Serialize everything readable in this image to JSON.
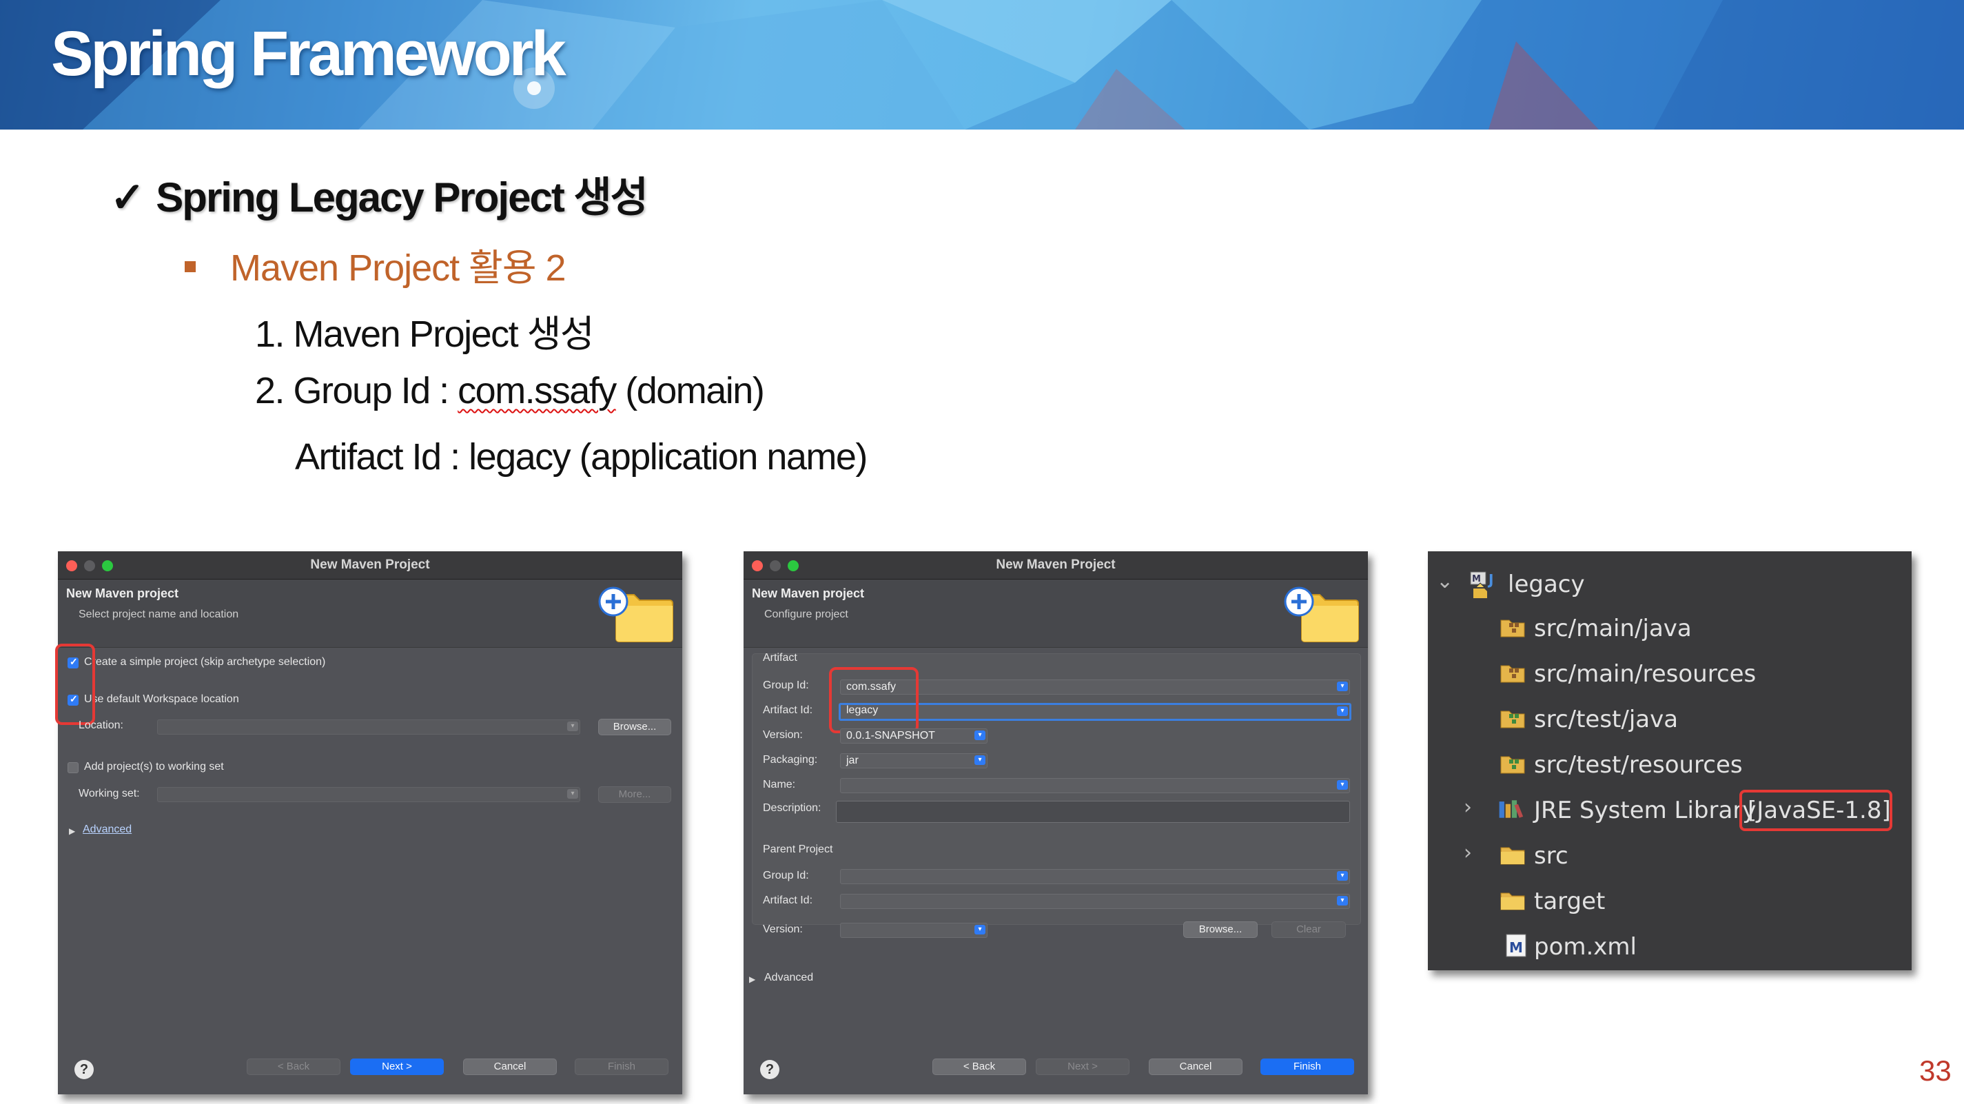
{
  "banner": {
    "title": "Spring Framework"
  },
  "slide": {
    "heading_check": "✓",
    "heading": "Spring Legacy Project 생성",
    "subheading": "Maven Project 활용 2",
    "step1": "1. Maven Project 생성",
    "step2_prefix": "2. Group Id : ",
    "step2_value": "com.ssafy",
    "step2_suffix": " (domain)",
    "step2_line2": "Artifact Id : legacy (application name)",
    "page_number": "33"
  },
  "dialog1": {
    "window_title": "New Maven Project",
    "header_title": "New Maven project",
    "header_subtitle": "Select project name and location",
    "simple_project_label": "Create a simple project (skip archetype selection)",
    "default_workspace_label": "Use default Workspace location",
    "location_label": "Location:",
    "location_value": "",
    "browse_label": "Browse...",
    "add_working_set_label": "Add project(s) to working set",
    "working_set_label": "Working set:",
    "more_label": "More...",
    "advanced_label": "Advanced",
    "back_label": "< Back",
    "next_label": "Next >",
    "cancel_label": "Cancel",
    "finish_label": "Finish",
    "simple_project_checked": true,
    "default_workspace_checked": true,
    "add_working_set_checked": false
  },
  "dialog2": {
    "window_title": "New Maven Project",
    "header_title": "New Maven project",
    "header_subtitle": "Configure project",
    "artifact_group_label": "Artifact",
    "group_id_label": "Group Id:",
    "group_id_value": "com.ssafy",
    "artifact_id_label": "Artifact Id:",
    "artifact_id_value": "legacy",
    "version_label": "Version:",
    "version_value": "0.0.1-SNAPSHOT",
    "packaging_label": "Packaging:",
    "packaging_value": "jar",
    "name_label": "Name:",
    "name_value": "",
    "description_label": "Description:",
    "description_value": "",
    "parent_group_label": "Parent Project",
    "parent_group_id_label": "Group Id:",
    "parent_artifact_id_label": "Artifact Id:",
    "parent_version_label": "Version:",
    "browse_label": "Browse...",
    "clear_label": "Clear",
    "advanced_label": "Advanced",
    "back_label": "< Back",
    "next_label": "Next >",
    "cancel_label": "Cancel",
    "finish_label": "Finish"
  },
  "explorer": {
    "project": "legacy",
    "items": [
      {
        "label": "src/main/java",
        "icon": "package-folder-icon"
      },
      {
        "label": "src/main/resources",
        "icon": "package-folder-icon"
      },
      {
        "label": "src/test/java",
        "icon": "test-package-folder-icon"
      },
      {
        "label": "src/test/resources",
        "icon": "test-package-folder-icon"
      },
      {
        "label": "JRE System Library",
        "suffix": "[JavaSE-1.8]",
        "icon": "library-icon"
      },
      {
        "label": "src",
        "icon": "folder-icon"
      },
      {
        "label": "target",
        "icon": "folder-icon"
      },
      {
        "label": "pom.xml",
        "icon": "maven-file-icon"
      }
    ]
  },
  "colors": {
    "accent_orange": "#c0632a",
    "highlight_red": "#e53935",
    "primary_button": "#1b6ef3"
  }
}
